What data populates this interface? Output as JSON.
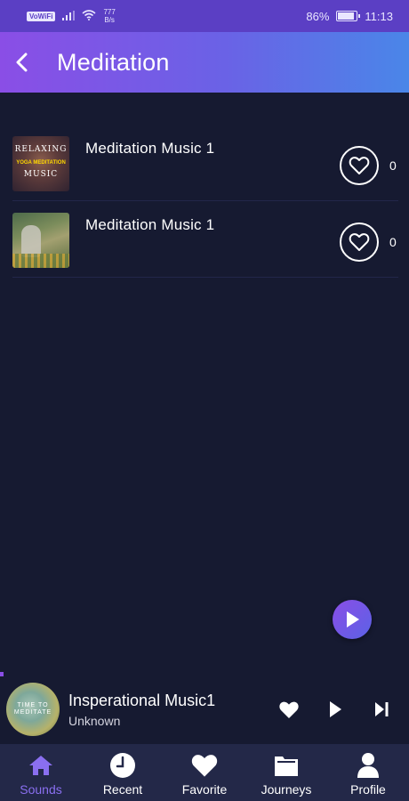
{
  "status_bar": {
    "network_badge": "VoWiFi",
    "net_speed_value": "777",
    "net_speed_unit": "B/s",
    "battery": "86%",
    "time": "11:13"
  },
  "header": {
    "title": "Meditation",
    "back_icon": "chevron-left-icon"
  },
  "tracks": [
    {
      "title": "Meditation Music 1",
      "thumb_line1": "RELAXING",
      "thumb_line2": "YOGA MEDITATION",
      "thumb_line3": "MUSIC",
      "favorite_count": "0"
    },
    {
      "title": "Meditation Music 1",
      "favorite_count": "0"
    }
  ],
  "now_playing": {
    "title": "Insperational Music1",
    "artist": "Unknown",
    "art_text": "TIME TO MEDITATE"
  },
  "nav": {
    "items": [
      {
        "label": "Sounds",
        "icon": "home-icon",
        "active": true
      },
      {
        "label": "Recent",
        "icon": "clock-icon",
        "active": false
      },
      {
        "label": "Favorite",
        "icon": "heart-icon",
        "active": false
      },
      {
        "label": "Journeys",
        "icon": "folder-icon",
        "active": false
      },
      {
        "label": "Profile",
        "icon": "user-icon",
        "active": false
      }
    ]
  },
  "colors": {
    "background": "#161a31",
    "header_gradient_start": "#8a4ee6",
    "header_gradient_end": "#4a86e8",
    "status_bar": "#5b3fc4",
    "nav_background": "#232848",
    "active_accent": "#8a6ff0"
  }
}
